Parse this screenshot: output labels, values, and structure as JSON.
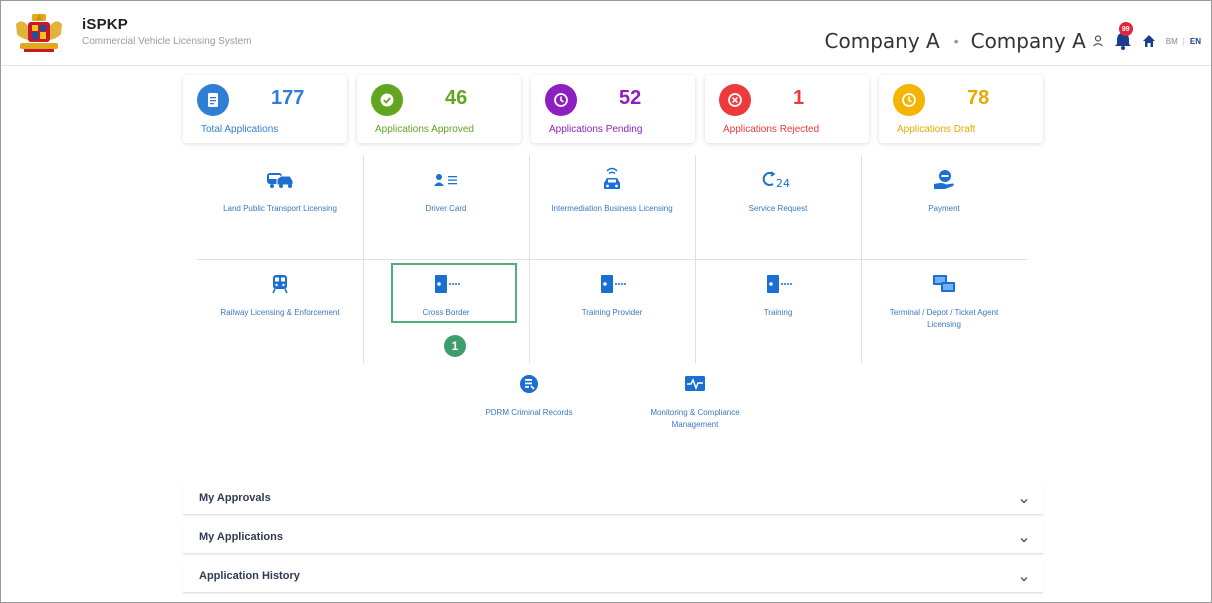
{
  "header": {
    "title": "iSPKP",
    "subtitle": "Commercial Vehicle Licensing System",
    "company_primary": "Company A",
    "company_secondary": "Company A",
    "notification_count": "99",
    "lang_bm": "BM",
    "lang_sep": "|",
    "lang_en": "EN",
    "icons": [
      "crest-logo",
      "user-icon",
      "bell-icon",
      "home-icon"
    ]
  },
  "stats": [
    {
      "value": "177",
      "label": "Total Applications",
      "color": "#2f7fd6",
      "icon": "document-icon"
    },
    {
      "value": "46",
      "label": "Applications Approved",
      "color": "#62a51f",
      "icon": "check-icon"
    },
    {
      "value": "52",
      "label": "Applications Pending",
      "color": "#8d1fc1",
      "icon": "history-icon"
    },
    {
      "value": "1",
      "label": "Applications Rejected",
      "color": "#ee3a3a",
      "icon": "cancel-icon"
    },
    {
      "value": "78",
      "label": "Applications Draft",
      "color": "#e7a900",
      "icon": "clock-icon"
    }
  ],
  "menu": [
    {
      "label": "Land Public Transport Licensing",
      "icon": "bus-car-icon"
    },
    {
      "label": "Driver Card",
      "icon": "driver-card-icon"
    },
    {
      "label": "Intermediation Business Licensing",
      "icon": "taxi-signal-icon"
    },
    {
      "label": "Service Request",
      "icon": "service-24-icon"
    },
    {
      "label": "Payment",
      "icon": "payment-hand-icon"
    },
    {
      "label": "Railway Licensing & Enforcement",
      "icon": "train-icon"
    },
    {
      "label": "Cross Border",
      "icon": "door-key-icon"
    },
    {
      "label": "Training Provider",
      "icon": "door-key-icon"
    },
    {
      "label": "Training",
      "icon": "door-key-icon"
    },
    {
      "label": "Terminal / Depot / Ticket Agent Licensing",
      "icon": "terminal-icon"
    },
    {
      "label": "PDRM Criminal Records",
      "icon": "records-icon"
    },
    {
      "label": "Monitoring & Compliance Management",
      "icon": "monitoring-icon"
    }
  ],
  "step_badge": "1",
  "accordions": [
    {
      "title": "My Approvals"
    },
    {
      "title": "My Applications"
    },
    {
      "title": "Application History"
    }
  ]
}
